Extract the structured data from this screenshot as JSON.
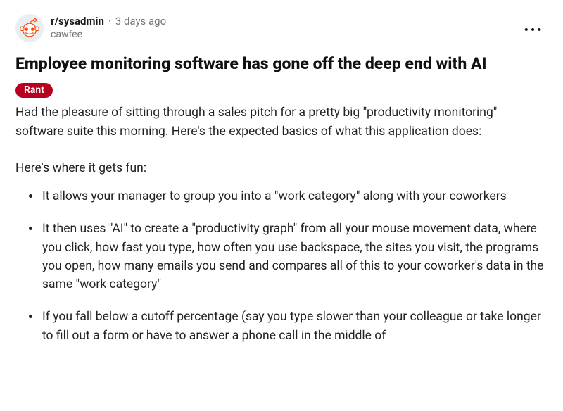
{
  "post": {
    "subreddit": "r/sysadmin",
    "separator": "·",
    "timestamp": "3 days ago",
    "author": "cawfee",
    "title": "Employee monitoring software has gone off the deep end with AI",
    "flair": "Rant",
    "paragraph1": "Had the pleasure of sitting through a sales pitch for a pretty big \"productivity monitoring\" software suite this morning. Here's the expected basics of what this application does:",
    "paragraph2": "Here's where it gets fun:",
    "bullets": [
      "It allows your manager to group you into a \"work category\" along with your coworkers",
      "It then uses \"AI\" to create a \"productivity graph\" from all your mouse movement data, where you click, how fast you type, how often you use backspace, the sites you visit, the programs you open, how many emails you send and compares all of this to your coworker's data in the same \"work category\"",
      "If you fall below a cutoff percentage (say you type slower than your colleague or take longer to fill out a form or have to answer a phone call in the middle of"
    ]
  },
  "icons": {
    "overflow": "..."
  }
}
